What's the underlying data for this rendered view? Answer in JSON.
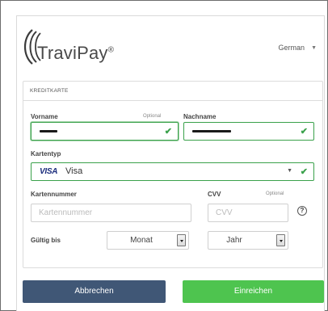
{
  "brand": {
    "name": "TraviPay",
    "reg": "®"
  },
  "language": {
    "selected": "German"
  },
  "section": {
    "title": "KREDITKARTE"
  },
  "form": {
    "firstname": {
      "label": "Vorname",
      "optional": "Optional"
    },
    "lastname": {
      "label": "Nachname"
    },
    "cardtype": {
      "label": "Kartentyp",
      "brand_mark": "VISA",
      "value": "Visa"
    },
    "cardnumber": {
      "label": "Kartennummer",
      "placeholder": "Kartennummer"
    },
    "cvv": {
      "label": "CVV",
      "optional": "Optional",
      "placeholder": "CVV",
      "help": "?"
    },
    "expiry": {
      "label": "Gültig bis",
      "month": "Monat",
      "year": "Jahr"
    }
  },
  "buttons": {
    "cancel": "Abbrechen",
    "submit": "Einreichen"
  },
  "colors": {
    "success": "#3aa14b",
    "cancel": "#405776",
    "submit": "#4ec44f",
    "visa": "#1a2c7c"
  }
}
